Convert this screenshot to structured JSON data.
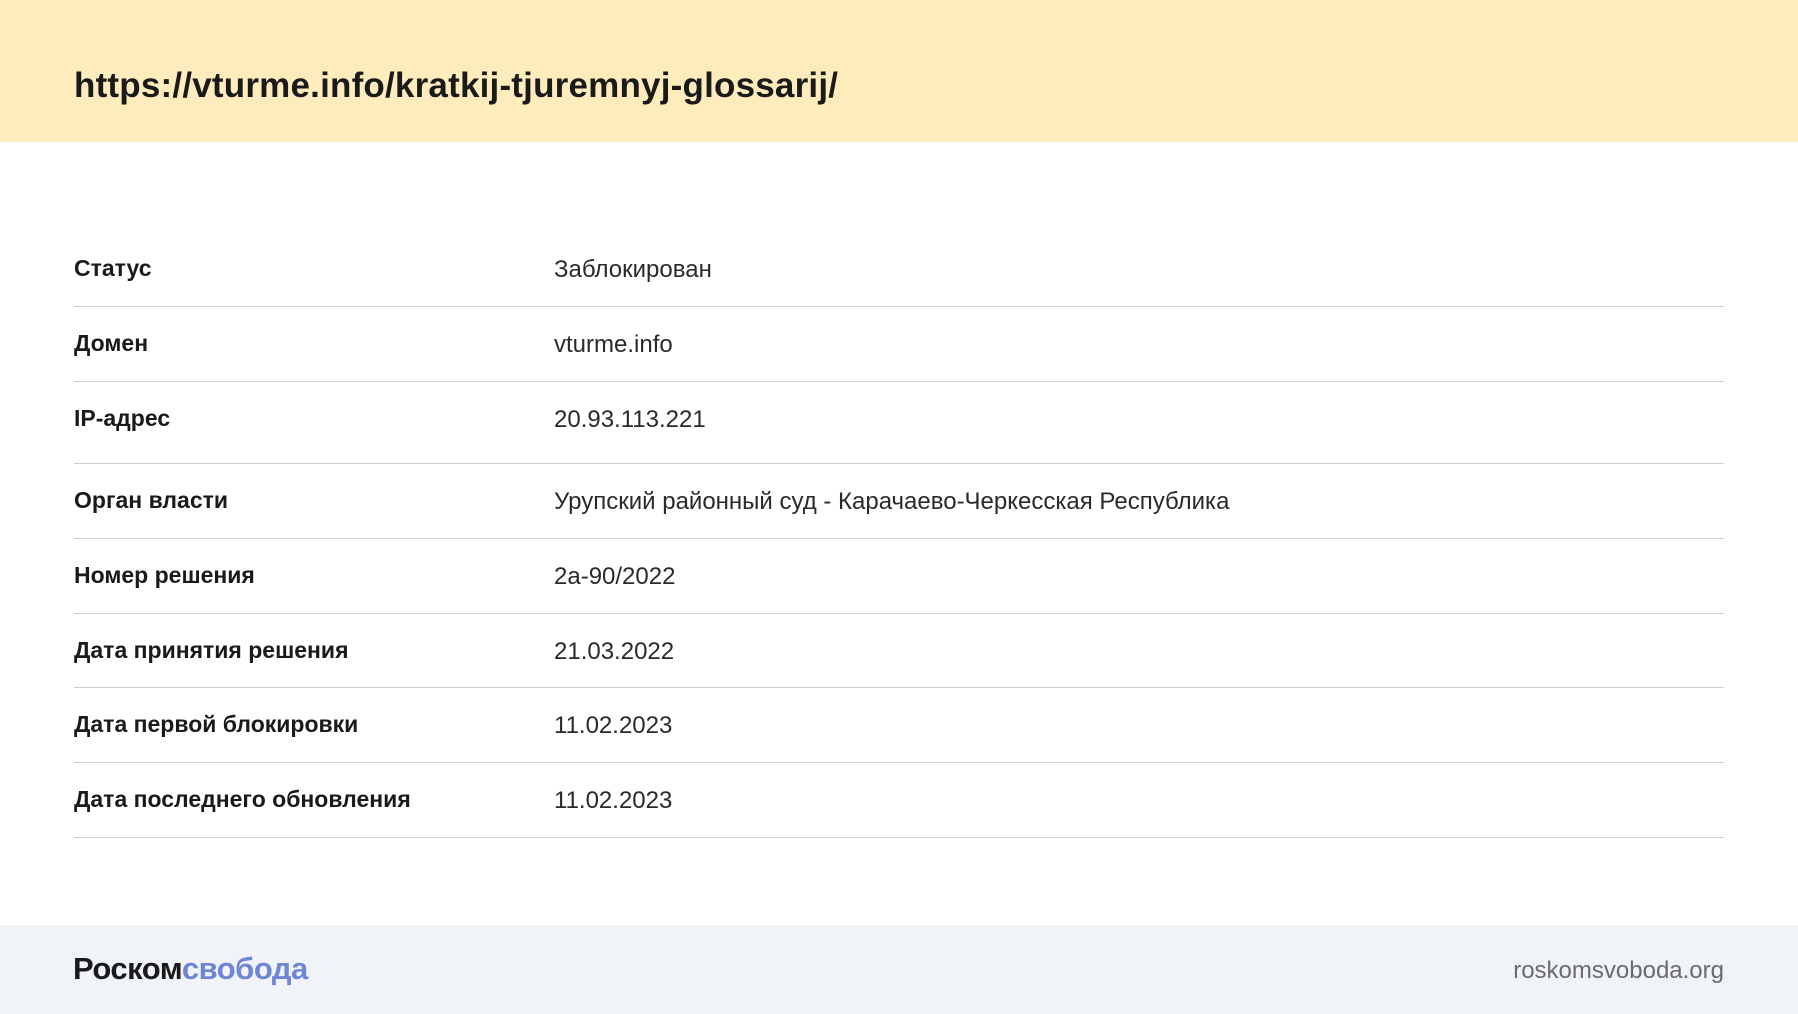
{
  "header": {
    "url": "https://vturme.info/kratkij-tjuremnyj-glossarij/"
  },
  "rows": [
    {
      "label": "Статус",
      "value": "Заблокирован"
    },
    {
      "label": "Домен",
      "value": "vturme.info"
    },
    {
      "label": "IP-адрес",
      "value": "20.93.113.221"
    },
    {
      "label": "Орган власти",
      "value": "Урупский районный суд - Карачаево-Черкесская Республика"
    },
    {
      "label": "Номер решения",
      "value": "2а-90/2022"
    },
    {
      "label": "Дата принятия решения",
      "value": "21.03.2022"
    },
    {
      "label": "Дата первой блокировки",
      "value": "11.02.2023"
    },
    {
      "label": "Дата последнего обновления",
      "value": "11.02.2023"
    }
  ],
  "footer": {
    "logo_part1": "Роском",
    "logo_part2": "свобода",
    "site": "roskomsvoboda.org"
  },
  "colors": {
    "header_bg": "#ffecbd",
    "footer_bg": "#f0f3f8",
    "logo_accent": "#6f86d6"
  }
}
